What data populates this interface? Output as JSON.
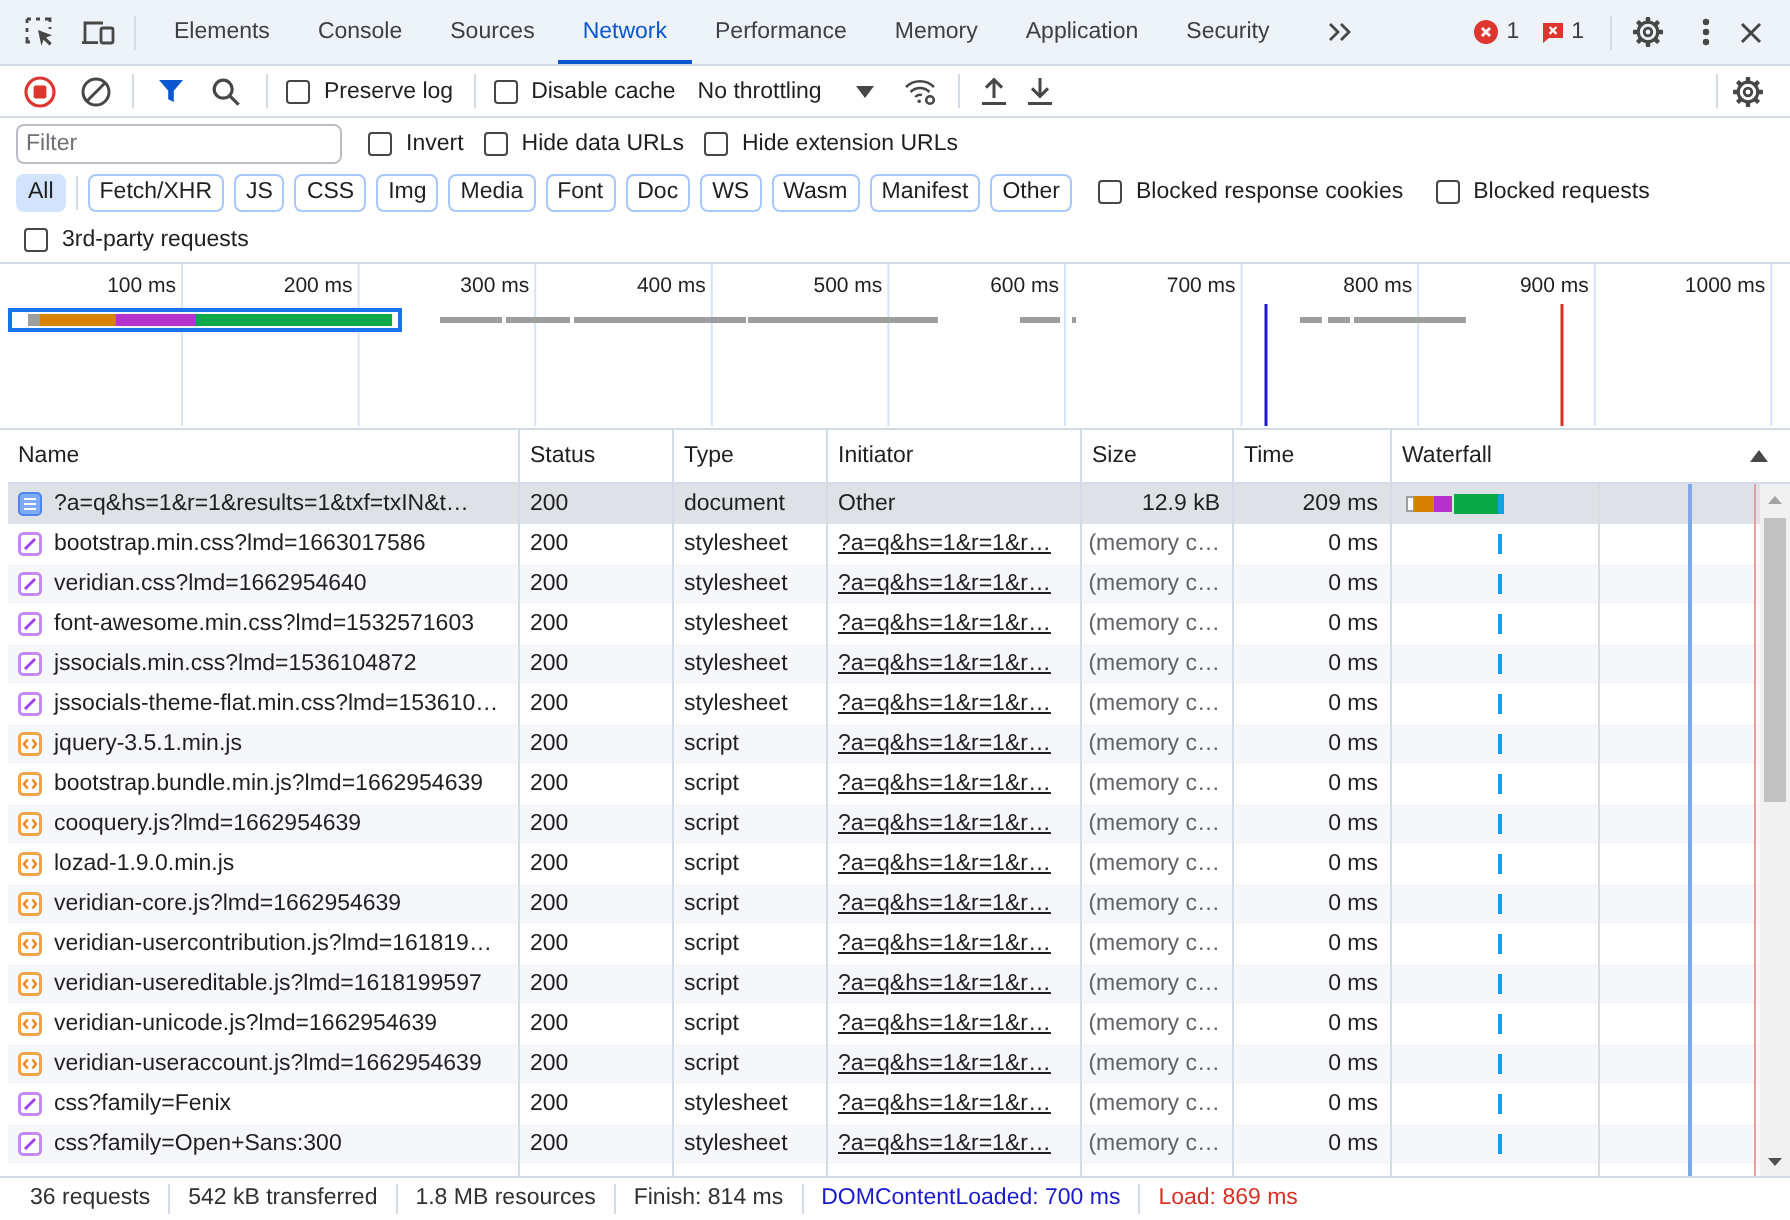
{
  "tabs_bar": {
    "tabs": [
      {
        "label": "Elements",
        "selected": false
      },
      {
        "label": "Console",
        "selected": false
      },
      {
        "label": "Sources",
        "selected": false
      },
      {
        "label": "Network",
        "selected": true
      },
      {
        "label": "Performance",
        "selected": false
      },
      {
        "label": "Memory",
        "selected": false
      },
      {
        "label": "Application",
        "selected": false
      },
      {
        "label": "Security",
        "selected": false
      }
    ],
    "counters": [
      {
        "kind": "error",
        "count": "1"
      },
      {
        "kind": "issue",
        "count": "1"
      }
    ]
  },
  "toolbar": {
    "preserve_log": {
      "label": "Preserve log",
      "checked": false
    },
    "disable_cache": {
      "label": "Disable cache",
      "checked": false
    },
    "throttling": "No throttling"
  },
  "filter_bar": {
    "filter": {
      "placeholder": "Filter"
    },
    "options": [
      {
        "label": "Invert",
        "checked": false
      },
      {
        "label": "Hide data URLs",
        "checked": false
      },
      {
        "label": "Hide extension URLs",
        "checked": false
      }
    ],
    "types": [
      {
        "label": "All",
        "selected": true
      },
      {
        "label": "Fetch/XHR",
        "selected": false
      },
      {
        "label": "JS",
        "selected": false
      },
      {
        "label": "CSS",
        "selected": false
      },
      {
        "label": "Img",
        "selected": false
      },
      {
        "label": "Media",
        "selected": false
      },
      {
        "label": "Font",
        "selected": false
      },
      {
        "label": "Doc",
        "selected": false
      },
      {
        "label": "WS",
        "selected": false
      },
      {
        "label": "Wasm",
        "selected": false
      },
      {
        "label": "Manifest",
        "selected": false
      },
      {
        "label": "Other",
        "selected": false
      }
    ],
    "more_options": [
      {
        "label": "Blocked response cookies",
        "checked": false
      },
      {
        "label": "Blocked requests",
        "checked": false
      }
    ],
    "third_party": {
      "label": "3rd-party requests",
      "checked": false
    }
  },
  "overview": {
    "ticks": [
      "100 ms",
      "200 ms",
      "300 ms",
      "400 ms",
      "500 ms",
      "600 ms",
      "700 ms",
      "800 ms",
      "900 ms",
      "1000 ms"
    ]
  },
  "table": {
    "columns": [
      "Name",
      "Status",
      "Type",
      "Initiator",
      "Size",
      "Time",
      "Waterfall"
    ],
    "rows": [
      {
        "kind": "document",
        "name": "?a=q&hs=1&r=1&results=1&txf=txIN&t…",
        "status": "200",
        "type": "document",
        "initiator": "Other",
        "initiator_link": false,
        "size": "12.9 kB",
        "from_cache": false,
        "time": "209 ms",
        "selected": true
      },
      {
        "kind": "stylesheet",
        "name": "bootstrap.min.css?lmd=1663017586",
        "status": "200",
        "type": "stylesheet",
        "initiator": "?a=q&hs=1&r=1&r…",
        "initiator_link": true,
        "size": "(memory c…",
        "from_cache": true,
        "time": "0 ms",
        "selected": false
      },
      {
        "kind": "stylesheet",
        "name": "veridian.css?lmd=1662954640",
        "status": "200",
        "type": "stylesheet",
        "initiator": "?a=q&hs=1&r=1&r…",
        "initiator_link": true,
        "size": "(memory c…",
        "from_cache": true,
        "time": "0 ms",
        "selected": false
      },
      {
        "kind": "stylesheet",
        "name": "font-awesome.min.css?lmd=1532571603",
        "status": "200",
        "type": "stylesheet",
        "initiator": "?a=q&hs=1&r=1&r…",
        "initiator_link": true,
        "size": "(memory c…",
        "from_cache": true,
        "time": "0 ms",
        "selected": false
      },
      {
        "kind": "stylesheet",
        "name": "jssocials.min.css?lmd=1536104872",
        "status": "200",
        "type": "stylesheet",
        "initiator": "?a=q&hs=1&r=1&r…",
        "initiator_link": true,
        "size": "(memory c…",
        "from_cache": true,
        "time": "0 ms",
        "selected": false
      },
      {
        "kind": "stylesheet",
        "name": "jssocials-theme-flat.min.css?lmd=153610…",
        "status": "200",
        "type": "stylesheet",
        "initiator": "?a=q&hs=1&r=1&r…",
        "initiator_link": true,
        "size": "(memory c…",
        "from_cache": true,
        "time": "0 ms",
        "selected": false
      },
      {
        "kind": "script",
        "name": "jquery-3.5.1.min.js",
        "status": "200",
        "type": "script",
        "initiator": "?a=q&hs=1&r=1&r…",
        "initiator_link": true,
        "size": "(memory c…",
        "from_cache": true,
        "time": "0 ms",
        "selected": false
      },
      {
        "kind": "script",
        "name": "bootstrap.bundle.min.js?lmd=1662954639",
        "status": "200",
        "type": "script",
        "initiator": "?a=q&hs=1&r=1&r…",
        "initiator_link": true,
        "size": "(memory c…",
        "from_cache": true,
        "time": "0 ms",
        "selected": false
      },
      {
        "kind": "script",
        "name": "cooquery.js?lmd=1662954639",
        "status": "200",
        "type": "script",
        "initiator": "?a=q&hs=1&r=1&r…",
        "initiator_link": true,
        "size": "(memory c…",
        "from_cache": true,
        "time": "0 ms",
        "selected": false
      },
      {
        "kind": "script",
        "name": "lozad-1.9.0.min.js",
        "status": "200",
        "type": "script",
        "initiator": "?a=q&hs=1&r=1&r…",
        "initiator_link": true,
        "size": "(memory c…",
        "from_cache": true,
        "time": "0 ms",
        "selected": false
      },
      {
        "kind": "script",
        "name": "veridian-core.js?lmd=1662954639",
        "status": "200",
        "type": "script",
        "initiator": "?a=q&hs=1&r=1&r…",
        "initiator_link": true,
        "size": "(memory c…",
        "from_cache": true,
        "time": "0 ms",
        "selected": false
      },
      {
        "kind": "script",
        "name": "veridian-usercontribution.js?lmd=161819…",
        "status": "200",
        "type": "script",
        "initiator": "?a=q&hs=1&r=1&r…",
        "initiator_link": true,
        "size": "(memory c…",
        "from_cache": true,
        "time": "0 ms",
        "selected": false
      },
      {
        "kind": "script",
        "name": "veridian-usereditable.js?lmd=1618199597",
        "status": "200",
        "type": "script",
        "initiator": "?a=q&hs=1&r=1&r…",
        "initiator_link": true,
        "size": "(memory c…",
        "from_cache": true,
        "time": "0 ms",
        "selected": false
      },
      {
        "kind": "script",
        "name": "veridian-unicode.js?lmd=1662954639",
        "status": "200",
        "type": "script",
        "initiator": "?a=q&hs=1&r=1&r…",
        "initiator_link": true,
        "size": "(memory c…",
        "from_cache": true,
        "time": "0 ms",
        "selected": false
      },
      {
        "kind": "script",
        "name": "veridian-useraccount.js?lmd=1662954639",
        "status": "200",
        "type": "script",
        "initiator": "?a=q&hs=1&r=1&r…",
        "initiator_link": true,
        "size": "(memory c…",
        "from_cache": true,
        "time": "0 ms",
        "selected": false
      },
      {
        "kind": "stylesheet",
        "name": "css?family=Fenix",
        "status": "200",
        "type": "stylesheet",
        "initiator": "?a=q&hs=1&r=1&r…",
        "initiator_link": true,
        "size": "(memory c…",
        "from_cache": true,
        "time": "0 ms",
        "selected": false
      },
      {
        "kind": "stylesheet",
        "name": "css?family=Open+Sans:300",
        "status": "200",
        "type": "stylesheet",
        "initiator": "?a=q&hs=1&r=1&r…",
        "initiator_link": true,
        "size": "(memory c…",
        "from_cache": true,
        "time": "0 ms",
        "selected": false
      }
    ]
  },
  "status_bar": [
    {
      "text": "36 requests",
      "color": "#303030"
    },
    {
      "text": "542 kB transferred",
      "color": "#303030"
    },
    {
      "text": "1.8 MB resources",
      "color": "#303030"
    },
    {
      "text": "Finish: 814 ms",
      "color": "#303030"
    },
    {
      "text": "DOMContentLoaded: 700 ms",
      "color": "#1a1acd"
    },
    {
      "text": "Load: 869 ms",
      "color": "#d93025"
    }
  ]
}
